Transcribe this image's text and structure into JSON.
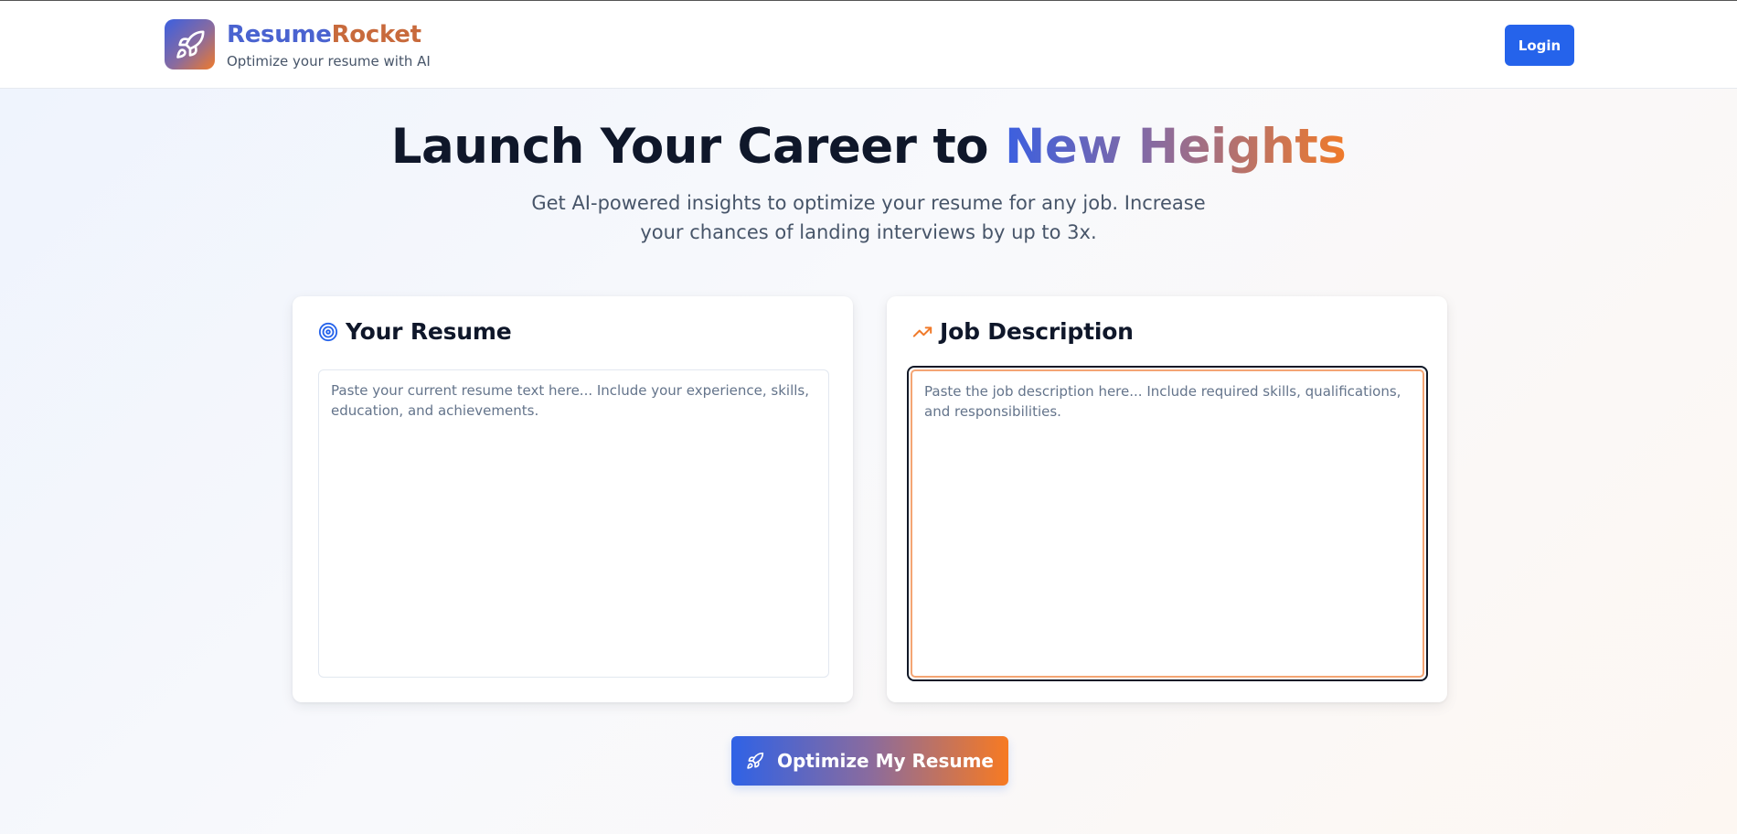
{
  "header": {
    "brand_part1": "Resume",
    "brand_part2": "Rocket",
    "tagline": "Optimize your resume with AI",
    "login_label": "Login",
    "logo_icon": "rocket-icon"
  },
  "hero": {
    "title_plain": "Launch Your Career to ",
    "title_highlight": "New Heights",
    "subtitle": "Get AI-powered insights to optimize your resume for any job. Increase your chances of landing interviews by up to 3x."
  },
  "resume_card": {
    "title": "Your Resume",
    "icon": "target-icon",
    "placeholder": "Paste your current resume text here... Include your experience, skills, education, and achievements.",
    "value": ""
  },
  "job_card": {
    "title": "Job Description",
    "icon": "trending-up-icon",
    "placeholder": "Paste the job description here... Include required skills, qualifications, and responsibilities.",
    "value": ""
  },
  "action": {
    "optimize_label": "Optimize My Resume",
    "icon": "rocket-icon"
  },
  "colors": {
    "primary": "#2563eb",
    "accent_orange": "#f07a2a",
    "gradient_start": "#3b5fe0",
    "gradient_end": "#f77a22"
  }
}
